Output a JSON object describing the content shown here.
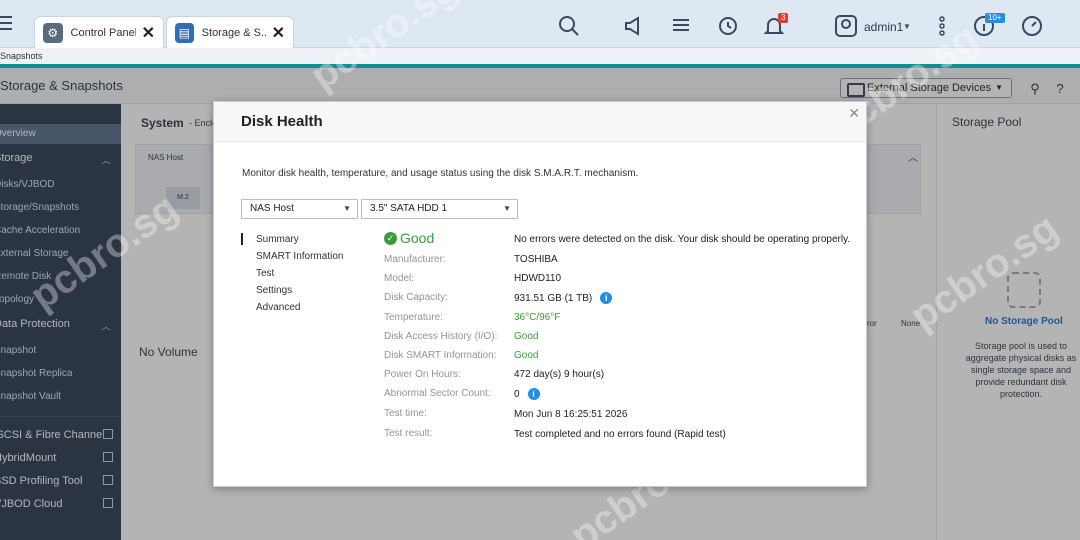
{
  "taskbar": {
    "tabs": [
      {
        "label": "Control Panel",
        "icon": "gear-icon"
      },
      {
        "label": "Storage & S...",
        "icon": "storage-icon"
      }
    ],
    "notification_badge": "3",
    "user": "admin1",
    "update_badge": "10+"
  },
  "subtitle_strip": "Snapshots",
  "app": {
    "title": "Storage & Snapshots",
    "external_storage_button": "External Storage Devices"
  },
  "sidebar": {
    "items": [
      {
        "label": "Overview",
        "selected": true
      },
      {
        "label": "Storage",
        "section": true
      },
      {
        "label": "Disks/VJBOD"
      },
      {
        "label": "Storage/Snapshots"
      },
      {
        "label": "Cache Acceleration"
      },
      {
        "label": "External Storage"
      },
      {
        "label": "Remote Disk"
      },
      {
        "label": "Topology"
      },
      {
        "label": "Data Protection",
        "section": true
      },
      {
        "label": "Snapshot"
      },
      {
        "label": "Snapshot Replica"
      },
      {
        "label": "Snapshot Vault"
      },
      {
        "label": "iSCSI & Fibre Channel",
        "section": true
      },
      {
        "label": "HybridMount",
        "section": true
      },
      {
        "label": "SSD Profiling Tool",
        "section": true
      },
      {
        "label": "VJBOD Cloud",
        "section": true
      }
    ]
  },
  "background": {
    "system_label": "System",
    "system_suffix": "- Enclo",
    "nas_host": "NAS Host",
    "m2": "M.2",
    "no_volume": "No Volume",
    "legend_error": "ror",
    "legend_none": "None",
    "storage_pool_title": "Storage Pool",
    "no_storage_pool": "No Storage Pool",
    "pool_description": "Storage pool is used to aggregate physical disks as single storage space and provide redundant disk protection."
  },
  "dialog": {
    "title": "Disk Health",
    "description": "Monitor disk health, temperature, and usage status using the disk S.M.A.R.T. mechanism.",
    "host_select": "NAS Host",
    "disk_select": "3.5\" SATA HDD 1",
    "nav": [
      "Summary",
      "SMART Information",
      "Test",
      "Settings",
      "Advanced"
    ],
    "status": "Good",
    "status_message": "No errors were detected on the disk. Your disk should be operating properly.",
    "rows": [
      {
        "label": "Manufacturer:",
        "value": "TOSHIBA"
      },
      {
        "label": "Model:",
        "value": "HDWD110"
      },
      {
        "label": "Disk Capacity:",
        "value": "931.51 GB (1 TB)"
      },
      {
        "label": "Temperature:",
        "value": "36°C/96°F"
      },
      {
        "label": "Disk Access History (I/O):",
        "value": "Good"
      },
      {
        "label": "Disk SMART Information:",
        "value": "Good"
      },
      {
        "label": "Power On Hours:",
        "value": "472 day(s) 9 hour(s)"
      },
      {
        "label": "Abnormal Sector Count:",
        "value": "0"
      },
      {
        "label": "Test time:",
        "value": "Mon Jun 8 16:25:51 2026"
      },
      {
        "label": "Test result:",
        "value": "Test completed and no errors found (Rapid test)"
      }
    ]
  },
  "watermark": "pcbro.sg",
  "colors": {
    "accent_teal": "#0f8f8f",
    "good_green": "#3c9c3c",
    "info_blue": "#1e8ee6",
    "sidebar_bg": "#2b3b52",
    "badge_red": "#e53935"
  }
}
